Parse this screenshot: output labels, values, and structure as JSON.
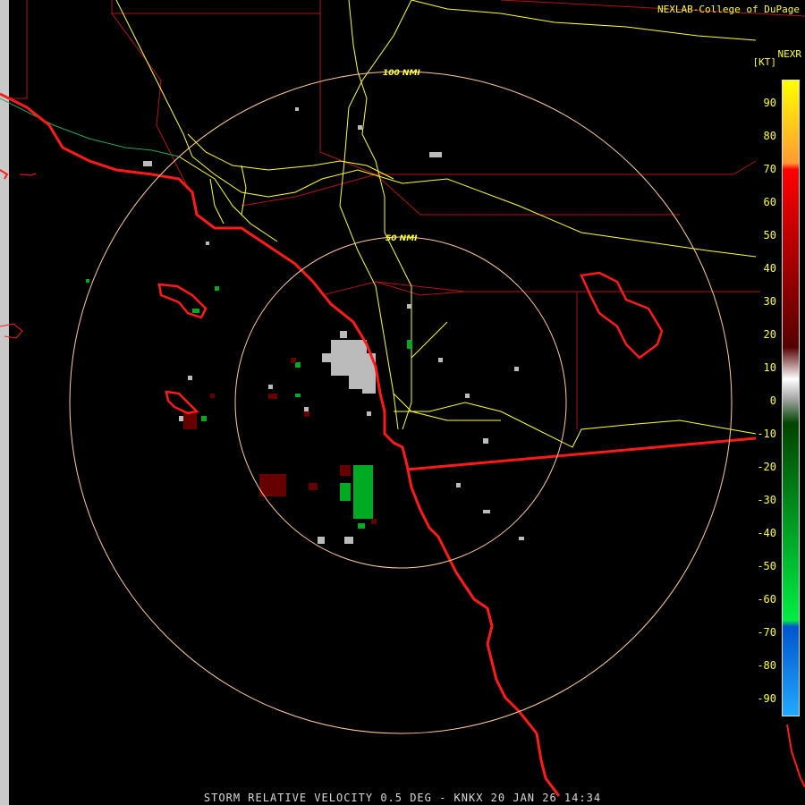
{
  "header": {
    "credit": "NEXLAB-College of DuPage"
  },
  "product": {
    "title": "NEXR",
    "units": "[KT]"
  },
  "footer": {
    "caption": "STORM RELATIVE VELOCITY 0.5 DEG - KNKX 20 JAN 26 14:34"
  },
  "range_rings": [
    {
      "label": "50 NMI"
    },
    {
      "label": "100 NMI"
    }
  ],
  "legend": {
    "ticks": [
      "90",
      "80",
      "70",
      "60",
      "50",
      "40",
      "30",
      "20",
      "10",
      "0",
      "-10",
      "-20",
      "-30",
      "-40",
      "-50",
      "-60",
      "-70",
      "-80",
      "-90"
    ],
    "colors": {
      "yellow": "#ffff00",
      "orange": "#ff9933",
      "red": "#ff0000",
      "dark_red": "#550000",
      "gray": "#aaaaaa",
      "dark_green": "#004400",
      "green": "#00ee44",
      "blue": "#0055cc",
      "light_blue": "#22aaff"
    }
  },
  "map_colors": {
    "coastline": "#ff1a1a",
    "county_lines": "#b01515",
    "highways": "#ffff33",
    "range_rings": "#ffcc99"
  }
}
